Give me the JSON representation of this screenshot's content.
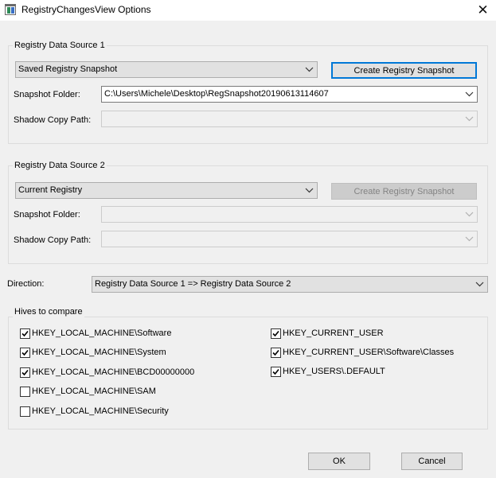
{
  "window": {
    "title": "RegistryChangesView Options",
    "icon": "registry-app-icon",
    "close_icon": "close-icon"
  },
  "source1": {
    "group_label": "Registry Data Source 1",
    "source_type": "Saved Registry Snapshot",
    "create_button": "Create Registry Snapshot",
    "snapshot_folder_label": "Snapshot Folder:",
    "snapshot_folder_value": "C:\\Users\\Michele\\Desktop\\RegSnapshot20190613114607",
    "shadow_copy_label": "Shadow Copy Path:",
    "shadow_copy_value": ""
  },
  "source2": {
    "group_label": "Registry Data Source 2",
    "source_type": "Current Registry",
    "create_button": "Create Registry Snapshot",
    "snapshot_folder_label": "Snapshot Folder:",
    "snapshot_folder_value": "",
    "shadow_copy_label": "Shadow Copy Path:",
    "shadow_copy_value": ""
  },
  "direction": {
    "label": "Direction:",
    "value": "Registry Data Source 1 => Registry Data Source 2"
  },
  "hives": {
    "group_label": "Hives to compare",
    "left": [
      {
        "label": "HKEY_LOCAL_MACHINE\\Software",
        "checked": true
      },
      {
        "label": "HKEY_LOCAL_MACHINE\\System",
        "checked": true
      },
      {
        "label": "HKEY_LOCAL_MACHINE\\BCD00000000",
        "checked": true
      },
      {
        "label": "HKEY_LOCAL_MACHINE\\SAM",
        "checked": false
      },
      {
        "label": "HKEY_LOCAL_MACHINE\\Security",
        "checked": false
      }
    ],
    "right": [
      {
        "label": "HKEY_CURRENT_USER",
        "checked": true
      },
      {
        "label": "HKEY_CURRENT_USER\\Software\\Classes",
        "checked": true
      },
      {
        "label": "HKEY_USERS\\.DEFAULT",
        "checked": true
      }
    ]
  },
  "buttons": {
    "ok": "OK",
    "cancel": "Cancel"
  },
  "colors": {
    "dialog_bg": "#f0f0f0",
    "focus_border": "#0078d7",
    "disabled_text": "#838383"
  }
}
